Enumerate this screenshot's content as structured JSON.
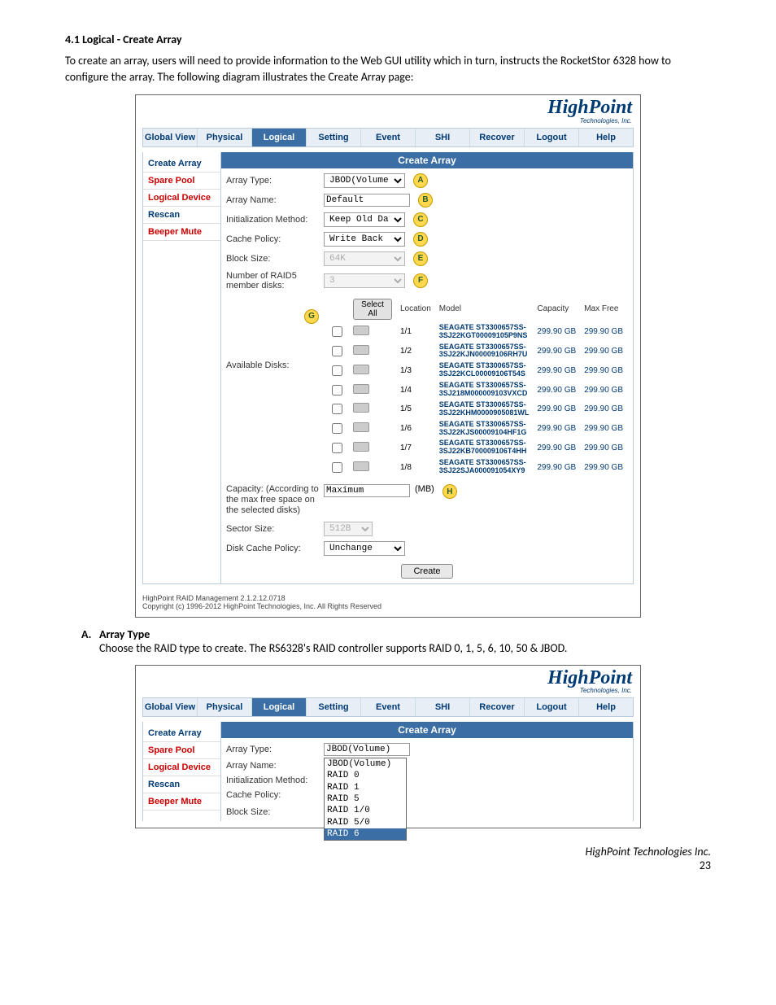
{
  "doc": {
    "section_title": "4.1 Logical - Create Array",
    "intro": "To create an array, users will need to provide information to the Web GUI utility which in turn, instructs the RocketStor 6328 how to configure the array. The following diagram illustrates the Create Array page:",
    "item_A_letter": "A.",
    "item_A_title": "Array Type",
    "item_A_body": "Choose the RAID type to create. The RS6328's RAID controller supports RAID 0, 1, 5, 6, 10, 50 & JBOD.",
    "footer_company": "HighPoint Technologies Inc.",
    "page_number": "23"
  },
  "brand": {
    "name": "HighPoint",
    "tagline": "Technologies, Inc."
  },
  "tabs": {
    "global_view": "Global View",
    "physical": "Physical",
    "logical": "Logical",
    "setting": "Setting",
    "event": "Event",
    "shi": "SHI",
    "recover": "Recover",
    "logout": "Logout",
    "help": "Help"
  },
  "sidebar": {
    "create_array": "Create Array",
    "spare_pool": "Spare Pool",
    "logical_device": "Logical Device",
    "rescan": "Rescan",
    "beeper_mute": "Beeper Mute"
  },
  "main_header": "Create Array",
  "form": {
    "array_type_label": "Array Type:",
    "array_type_value": "JBOD(Volume)",
    "array_name_label": "Array Name:",
    "array_name_value": "Default",
    "init_label": "Initialization Method:",
    "init_value": "Keep Old Dat",
    "cache_label": "Cache Policy:",
    "cache_value": "Write Back",
    "block_label": "Block Size:",
    "block_value": "64K",
    "raid5_label": "Number of RAID5 member disks:",
    "raid5_value": "3",
    "avail_label": "Available Disks:",
    "select_all": "Select All",
    "col_location": "Location",
    "col_model": "Model",
    "col_capacity": "Capacity",
    "col_maxfree": "Max Free",
    "capacity_label": "Capacity: (According to the max free space on the selected disks)",
    "capacity_value": "Maximum",
    "capacity_unit": "(MB)",
    "sector_label": "Sector Size:",
    "sector_value": "512B",
    "diskcache_label": "Disk Cache Policy:",
    "diskcache_value": "Unchange",
    "create_btn": "Create"
  },
  "disks": [
    {
      "loc": "1/1",
      "model": "SEAGATE ST3300657SS-3SJ22KGT00009105P9NS",
      "cap": "299.90 GB",
      "free": "299.90 GB"
    },
    {
      "loc": "1/2",
      "model": "SEAGATE ST3300657SS-3SJ22KJN00009106RH7U",
      "cap": "299.90 GB",
      "free": "299.90 GB"
    },
    {
      "loc": "1/3",
      "model": "SEAGATE ST3300657SS-3SJ22KCL00009106T54S",
      "cap": "299.90 GB",
      "free": "299.90 GB"
    },
    {
      "loc": "1/4",
      "model": "SEAGATE ST3300657SS-3SJ218M000009103VXCD",
      "cap": "299.90 GB",
      "free": "299.90 GB"
    },
    {
      "loc": "1/5",
      "model": "SEAGATE ST3300657SS-3SJ22KHM0000905081WL",
      "cap": "299.90 GB",
      "free": "299.90 GB"
    },
    {
      "loc": "1/6",
      "model": "SEAGATE ST3300657SS-3SJ22KJS00009104HF1G",
      "cap": "299.90 GB",
      "free": "299.90 GB"
    },
    {
      "loc": "1/7",
      "model": "SEAGATE ST3300657SS-3SJ22KB700009106T4HH",
      "cap": "299.90 GB",
      "free": "299.90 GB"
    },
    {
      "loc": "1/8",
      "model": "SEAGATE ST3300657SS-3SJ22SJA000091054XY9",
      "cap": "299.90 GB",
      "free": "299.90 GB"
    }
  ],
  "badges": {
    "A": "A",
    "B": "B",
    "C": "C",
    "D": "D",
    "E": "E",
    "F": "F",
    "G": "G",
    "H": "H"
  },
  "footer": {
    "line1": "HighPoint RAID Management 2.1.2.12.0718",
    "line2": "Copyright (c) 1996-2012 HighPoint Technologies, Inc. All Rights Reserved"
  },
  "dropdown": {
    "options": [
      "JBOD(Volume)",
      "RAID 0",
      "RAID 1",
      "RAID 5",
      "RAID 1/0",
      "RAID 5/0",
      "RAID 6"
    ],
    "selected": "RAID 6"
  }
}
